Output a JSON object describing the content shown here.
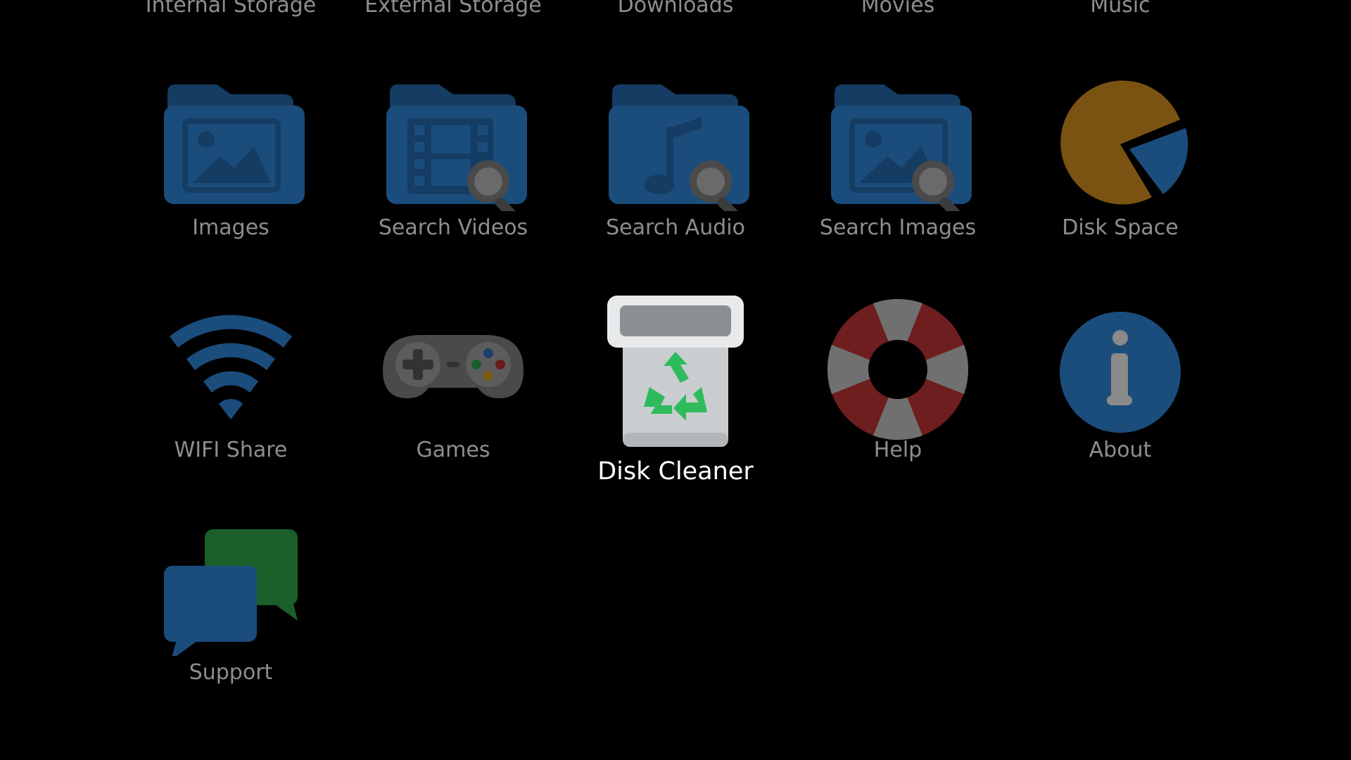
{
  "top_row": [
    {
      "label": "Internal Storage"
    },
    {
      "label": "External Storage"
    },
    {
      "label": "Downloads"
    },
    {
      "label": "Movies"
    },
    {
      "label": "Music"
    }
  ],
  "tiles": [
    {
      "label": "Images",
      "icon": "images-folder-icon"
    },
    {
      "label": "Search Videos",
      "icon": "search-videos-folder-icon"
    },
    {
      "label": "Search Audio",
      "icon": "search-audio-folder-icon"
    },
    {
      "label": "Search Images",
      "icon": "search-images-folder-icon"
    },
    {
      "label": "Disk Space",
      "icon": "pie-chart-icon"
    },
    {
      "label": "WIFI Share",
      "icon": "wifi-icon"
    },
    {
      "label": "Games",
      "icon": "gamepad-icon"
    },
    {
      "label": "Disk Cleaner",
      "icon": "recycle-bin-icon",
      "focused": true
    },
    {
      "label": "Help",
      "icon": "lifebuoy-icon"
    },
    {
      "label": "About",
      "icon": "info-icon"
    },
    {
      "label": "Support",
      "icon": "chat-bubbles-icon"
    }
  ],
  "colors": {
    "background": "#000000",
    "folder": "#1b4d7c",
    "folder_dark": "#153d63",
    "label_dim": "#8e8e8e",
    "label_focused": "#ffffff",
    "pie_orange": "#7a5212",
    "recycle_green": "#2dbb5c",
    "lifebuoy_red": "#6e1e1e",
    "lifebuoy_gray": "#707070",
    "chat_green": "#1b5e2a"
  }
}
